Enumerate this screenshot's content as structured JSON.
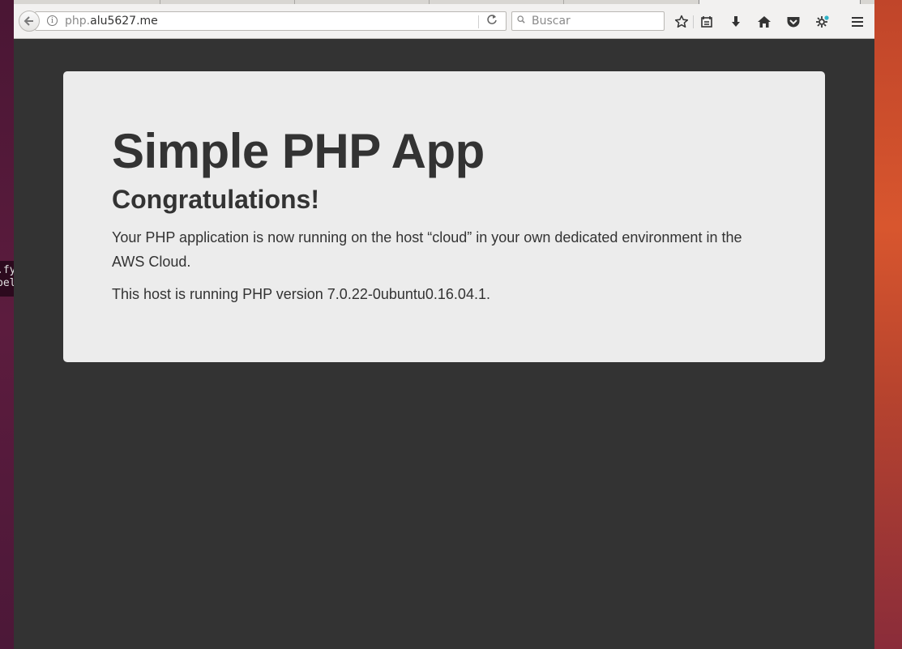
{
  "browser": {
    "url_prefix": "php.",
    "url_domain": "alu5627.me",
    "search_placeholder": "Buscar",
    "toolbar_icons": [
      "back-icon",
      "info-icon",
      "reload-icon",
      "search-icon",
      "bookmark-star-icon",
      "reading-list-icon",
      "download-icon",
      "home-icon",
      "pocket-icon",
      "extension-icon",
      "menu-icon"
    ]
  },
  "desktop": {
    "terminal_lines": [
      ".fy",
      "pel"
    ]
  },
  "page": {
    "title": "Simple PHP App",
    "subtitle": "Congratulations!",
    "paragraph1": "Your PHP application is now running on the host “cloud” in your own dedicated environment in the AWS Cloud.",
    "paragraph2": "This host is running PHP version 7.0.22-0ubuntu0.16.04.1."
  },
  "colors": {
    "page_background": "#333333",
    "panel_background": "#ececec",
    "text": "#333333"
  }
}
